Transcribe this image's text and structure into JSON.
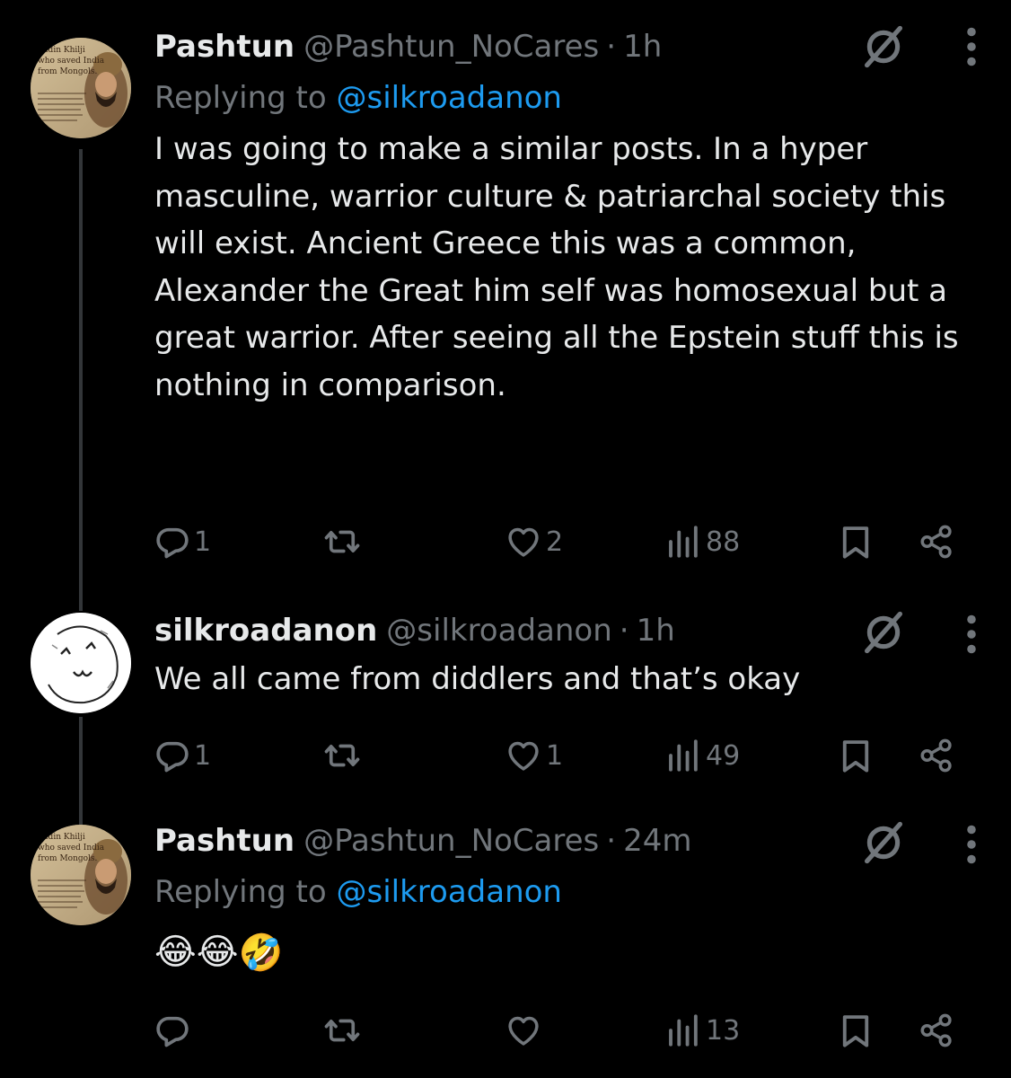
{
  "tweets": [
    {
      "display_name": "Pashtun",
      "handle": "@Pashtun_NoCares",
      "separator": "·",
      "time": "1h",
      "replying_label": "Replying to",
      "replying_to": "@silkroadanon",
      "text": "I was going to make a similar posts. In a hyper masculine, warrior culture & patriarchal society this will exist. Ancient Greece this was a common, Alexander the Great him self was homosexual but a great warrior. After seeing all the Epstein stuff this is nothing in comparison.",
      "avatar_text": [
        "uddin Khilji",
        "who saved India",
        "from Mongols."
      ],
      "stats": {
        "replies": "1",
        "reposts": "",
        "likes": "2",
        "views": "88"
      }
    },
    {
      "display_name": "silkroadanon",
      "handle": "@silkroadanon",
      "separator": "·",
      "time": "1h",
      "text": "We all came from diddlers and that’s okay",
      "stats": {
        "replies": "1",
        "reposts": "",
        "likes": "1",
        "views": "49"
      }
    },
    {
      "display_name": "Pashtun",
      "handle": "@Pashtun_NoCares",
      "separator": "·",
      "time": "24m",
      "replying_label": "Replying to",
      "replying_to": "@silkroadanon",
      "emojis": [
        "😂",
        "😂",
        "🤣"
      ],
      "avatar_text": [
        "uddin Khilji",
        "who saved India",
        "from Mongols."
      ],
      "stats": {
        "replies": "",
        "reposts": "",
        "likes": "",
        "views": "13"
      }
    }
  ],
  "colors": {
    "background": "#000000",
    "text": "#e7e9ea",
    "secondary": "#71767b",
    "link": "#1d9bf0",
    "thread_line": "#333639"
  },
  "icons": [
    "grok-icon",
    "more-options-icon",
    "reply-icon",
    "repost-icon",
    "like-icon",
    "views-icon",
    "bookmark-icon",
    "share-icon"
  ]
}
